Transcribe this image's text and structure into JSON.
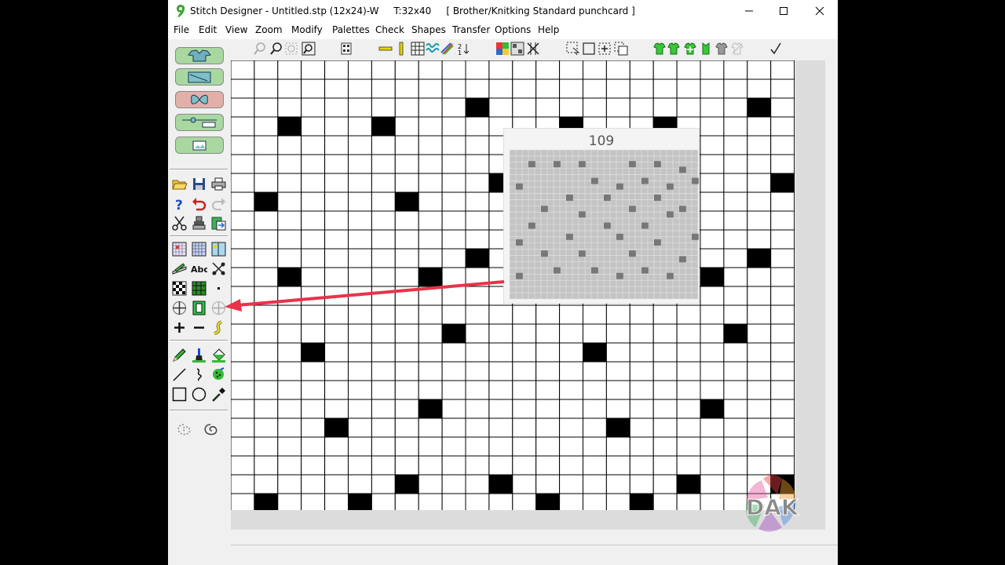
{
  "window": {
    "title": "Stitch Designer - Untitled.stp (12x24)-W",
    "template_size": "T:32x40",
    "machine_label": "[ Brother/Knitking Standard punchcard ]"
  },
  "menu": [
    "File",
    "Edit",
    "View",
    "Zoom",
    "Modify",
    "Palettes",
    "Check",
    "Shapes",
    "Transfer",
    "Options",
    "Help"
  ],
  "popup": {
    "number": "109"
  },
  "grid": {
    "cols": 24,
    "rows": 24,
    "filled_cells": [
      [
        2,
        10
      ],
      [
        2,
        22
      ],
      [
        3,
        2
      ],
      [
        3,
        6
      ],
      [
        3,
        14
      ],
      [
        3,
        18
      ],
      [
        6,
        11
      ],
      [
        6,
        23
      ],
      [
        7,
        1
      ],
      [
        7,
        7
      ],
      [
        10,
        10
      ],
      [
        10,
        22
      ],
      [
        11,
        2
      ],
      [
        11,
        8
      ],
      [
        11,
        20
      ],
      [
        14,
        9
      ],
      [
        14,
        21
      ],
      [
        15,
        3
      ],
      [
        15,
        15
      ],
      [
        18,
        8
      ],
      [
        18,
        20
      ],
      [
        19,
        4
      ],
      [
        19,
        16
      ],
      [
        22,
        7
      ],
      [
        22,
        11
      ],
      [
        22,
        19
      ],
      [
        22,
        23
      ],
      [
        23,
        1
      ],
      [
        23,
        5
      ],
      [
        23,
        13
      ],
      [
        23,
        17
      ]
    ]
  },
  "colors": {
    "arrow": "#e8334a",
    "pill_shirt": "#a8d8a0",
    "pill_butterfly": "#e2b0a8"
  },
  "watermark": {
    "text": "DAK"
  }
}
